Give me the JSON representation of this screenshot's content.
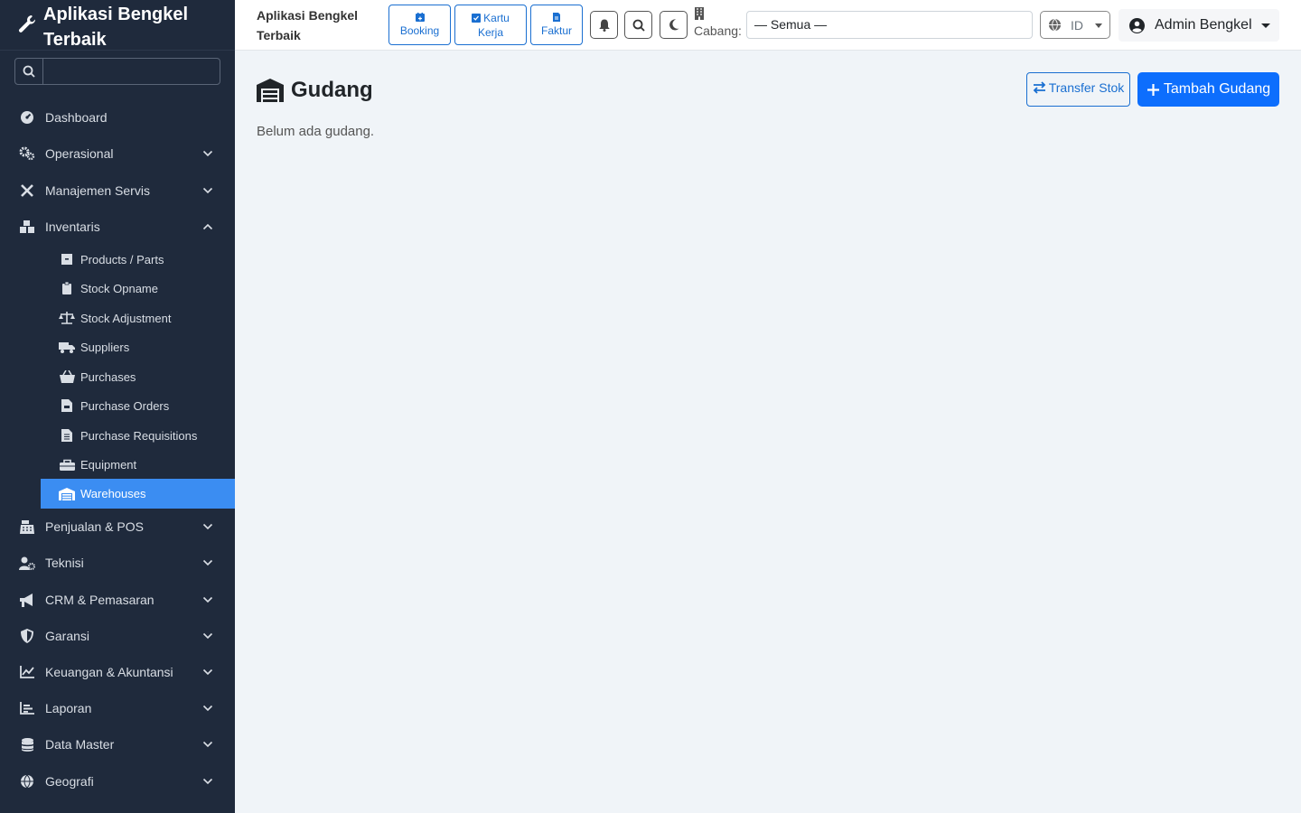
{
  "sidebar": {
    "brand_line1": "Aplikasi Bengkel",
    "brand_line2": "Terbaik",
    "search_placeholder": "",
    "items": [
      {
        "label": "Dashboard",
        "icon": "dashboard-icon",
        "chevron": null
      },
      {
        "label": "Operasional",
        "icon": "cogs-icon",
        "chevron": "down"
      },
      {
        "label": "Manajemen Servis",
        "icon": "tools-icon",
        "chevron": "down"
      },
      {
        "label": "Inventaris",
        "icon": "boxes-icon",
        "chevron": "up"
      }
    ],
    "sub_items": [
      {
        "label": "Products / Parts",
        "icon": "box-icon"
      },
      {
        "label": "Stock Opname",
        "icon": "clipboard-icon"
      },
      {
        "label": "Stock Adjustment",
        "icon": "balance-scale-icon"
      },
      {
        "label": "Suppliers",
        "icon": "truck-icon"
      },
      {
        "label": "Purchases",
        "icon": "basket-icon"
      },
      {
        "label": "Purchase Orders",
        "icon": "file-invoice-icon"
      },
      {
        "label": "Purchase Requisitions",
        "icon": "file-list-icon"
      },
      {
        "label": "Equipment",
        "icon": "toolbox-icon"
      },
      {
        "label": "Warehouses",
        "icon": "warehouse-icon"
      }
    ],
    "items_after": [
      {
        "label": "Penjualan & POS",
        "icon": "cash-register-icon"
      },
      {
        "label": "Teknisi",
        "icon": "user-cog-icon"
      },
      {
        "label": "CRM & Pemasaran",
        "icon": "bullhorn-icon"
      },
      {
        "label": "Garansi",
        "icon": "shield-icon"
      },
      {
        "label": "Keuangan & Akuntansi",
        "icon": "chart-line-icon"
      },
      {
        "label": "Laporan",
        "icon": "chart-bar-icon"
      },
      {
        "label": "Data Master",
        "icon": "database-icon"
      },
      {
        "label": "Geografi",
        "icon": "globe-icon"
      }
    ]
  },
  "topbar": {
    "title_line1": "Aplikasi Bengkel",
    "title_line2": "Terbaik",
    "booking_label": "Booking",
    "kartu_line1": "Kartu",
    "kartu_line2": "Kerja",
    "faktur_label": "Faktur",
    "branch_label": "Cabang:",
    "branch_value": "— Semua —",
    "lang_value": "ID",
    "user_name": "Admin Bengkel"
  },
  "main": {
    "title": "Gudang",
    "transfer_label": "Transfer Stok",
    "add_label": "Tambah Gudang",
    "empty_text": "Belum ada gudang."
  },
  "colors": {
    "sidebar_bg": "#1f2a3c",
    "active_item": "#3b8df2",
    "primary": "#0d6efd",
    "page_bg": "#f0f4f8"
  }
}
